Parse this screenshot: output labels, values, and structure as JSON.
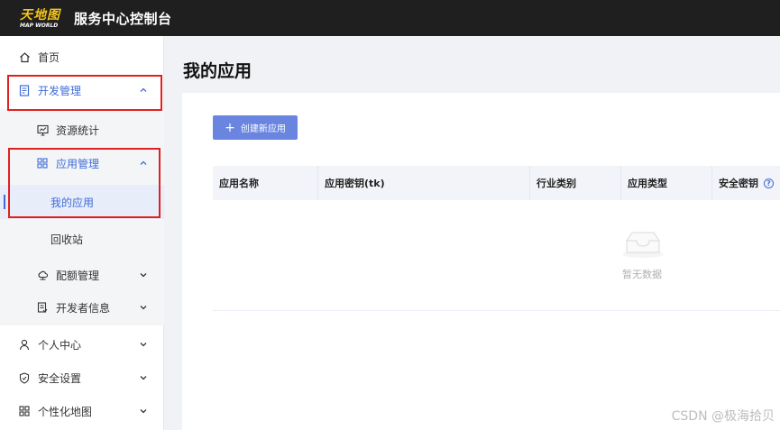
{
  "header": {
    "logo_cn": "天地图",
    "logo_en": "MAP WORLD",
    "title": "服务中心控制台"
  },
  "sidebar": {
    "items": [
      {
        "label": "首页",
        "icon": "home-icon"
      },
      {
        "label": "开发管理",
        "icon": "document-icon",
        "expanded": true
      },
      {
        "label": "资源统计",
        "icon": "monitor-chart-icon"
      },
      {
        "label": "应用管理",
        "icon": "grid-apps-icon",
        "expanded": true
      },
      {
        "label": "我的应用",
        "selected": true
      },
      {
        "label": "回收站"
      },
      {
        "label": "配额管理",
        "icon": "cloud-network-icon"
      },
      {
        "label": "开发者信息",
        "icon": "id-card-icon"
      },
      {
        "label": "个人中心",
        "icon": "user-icon"
      },
      {
        "label": "安全设置",
        "icon": "shield-icon"
      },
      {
        "label": "个性化地图",
        "icon": "grid-apps-icon"
      }
    ]
  },
  "main": {
    "page_title": "我的应用",
    "create_button": "创建新应用",
    "table": {
      "columns": [
        "应用名称",
        "应用密钥(tk)",
        "行业类别",
        "应用类型",
        "安全密钥"
      ],
      "rows": [],
      "empty_text": "暂无数据"
    }
  },
  "watermark": "CSDN @极海拾贝",
  "colors": {
    "accent": "#3f6bd8",
    "button": "#6a85e0",
    "topbar": "#1f1f1f",
    "annotation": "#e02020"
  }
}
